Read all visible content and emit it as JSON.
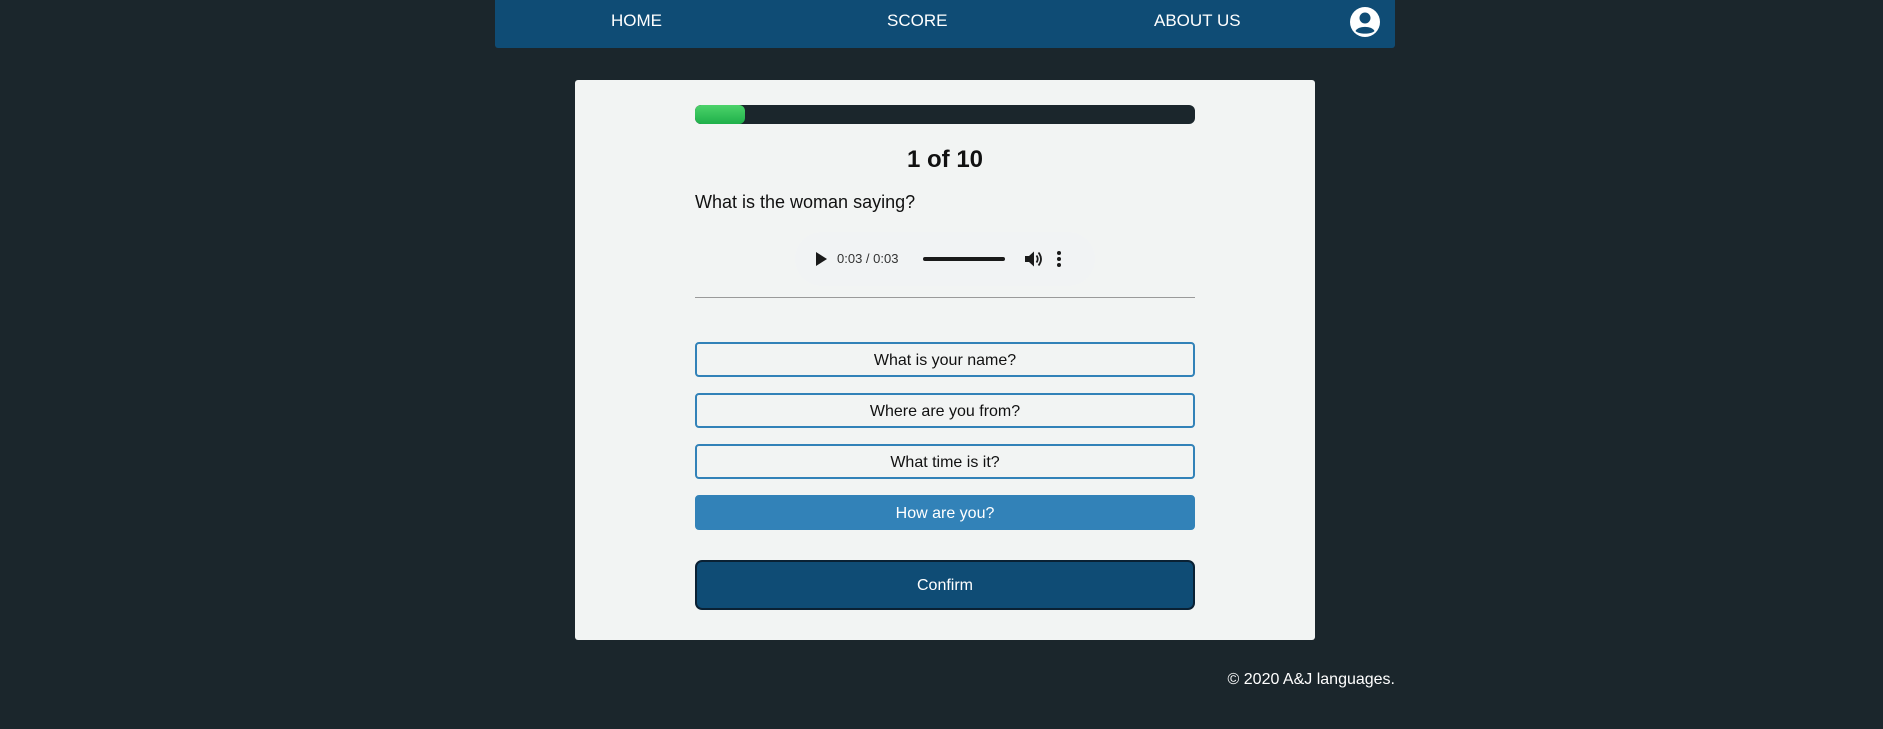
{
  "nav": {
    "home": "HOME",
    "score": "SCORE",
    "about": "ABOUT US",
    "user_icon": "account-circle-icon"
  },
  "quiz": {
    "progress": 0.1,
    "current": "1",
    "of_label": " of ",
    "total": "10",
    "question": "What is the woman saying?",
    "audio": {
      "time": "0:03 / 0:03",
      "icons": [
        "play-icon",
        "volume-icon",
        "more-vertical-icon"
      ]
    },
    "options": [
      "What is your name?",
      "Where are you from?",
      "What time is it?",
      "How are you?"
    ],
    "selected_option": "How are you?",
    "confirm_label": "Confirm"
  },
  "footer": {
    "copyright": "© 2020 A&J languages."
  },
  "colors": {
    "page_bg": "#1b262c",
    "navbar_bg": "#0f4c75",
    "card_bg": "#f2f4f3",
    "accent": "#3282b8",
    "progress": "#1fb04a"
  }
}
